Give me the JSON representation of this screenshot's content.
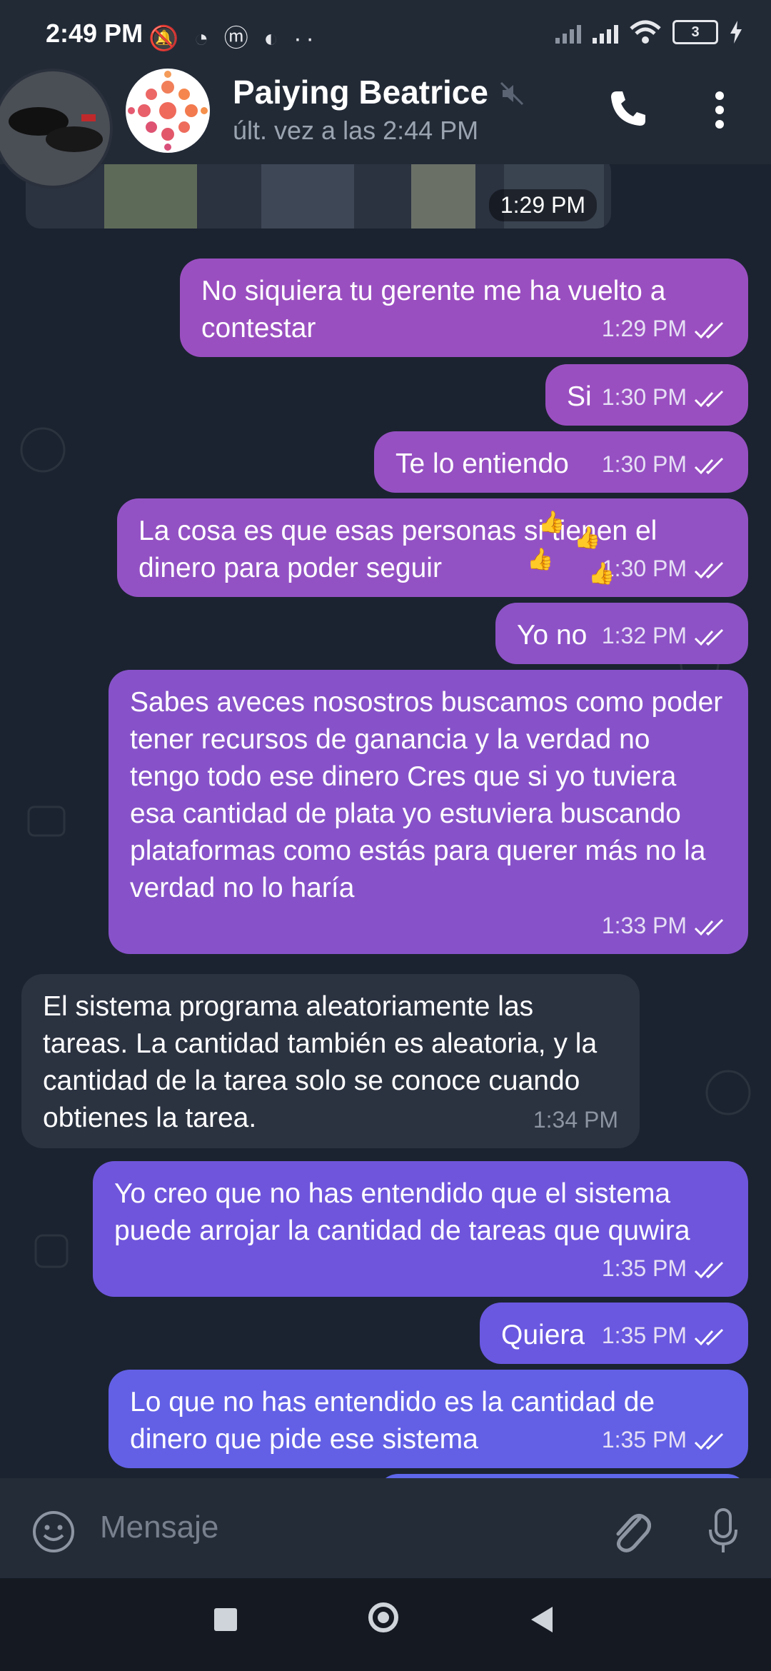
{
  "status_bar": {
    "time": "2:49 PM",
    "left_icons": "🔕 ◔ ⓜ ◐ ··",
    "battery_level": "3"
  },
  "header": {
    "contact_name": "Paiying Beatrice",
    "last_seen": "últ. vez a las 2:44 PM",
    "icons": [
      "mute-icon",
      "phone-icon",
      "more-vert-icon"
    ]
  },
  "chat": {
    "image_message_time": "1:29 PM",
    "messages": [
      {
        "direction": "out",
        "text": "No siquiera tu gerente me ha vuelto a contestar",
        "time": "1:29 PM",
        "color": "#9a4fc0"
      },
      {
        "direction": "out",
        "text": "Si",
        "time": "1:30 PM",
        "color": "#9a4fc0"
      },
      {
        "direction": "out",
        "text": "Te lo entiendo",
        "time": "1:30 PM",
        "color": "#9650c2"
      },
      {
        "direction": "out",
        "text": "La cosa es que esas personas si tienen el dinero para poder seguir",
        "time": "1:30 PM",
        "color": "#9352c4"
      },
      {
        "direction": "out",
        "text": "Yo no",
        "time": "1:32 PM",
        "color": "#8d52c6"
      },
      {
        "direction": "out",
        "text": "Sabes aveces nosostros buscamos como poder tener recursos de ganancia y la verdad no tengo todo ese dinero Cres que si yo tuviera esa cantidad de plata yo estuviera buscando plataformas como estás para querer más no la verdad no lo haría",
        "time": "1:33 PM",
        "color": "#8752c9"
      },
      {
        "direction": "in",
        "text": "El sistema programa aleatoriamente las tareas. La cantidad también es aleatoria, y la cantidad de la tarea solo se conoce cuando obtienes la tarea.",
        "time": "1:34 PM",
        "color": "#2b3240"
      },
      {
        "direction": "out",
        "text": "Yo creo que no has entendido que el sistema puede arrojar la cantidad de tareas que quwira",
        "time": "1:35 PM",
        "color": "#6f55dc"
      },
      {
        "direction": "out",
        "text": "Quiera",
        "time": "1:35 PM",
        "color": "#6a58e0"
      },
      {
        "direction": "out",
        "text": "Lo que no has entendido es la cantidad de dinero que pide ese sistema",
        "time": "1:35 PM",
        "color": "#6360e6"
      }
    ]
  },
  "input_bar": {
    "placeholder": "Mensaje"
  }
}
